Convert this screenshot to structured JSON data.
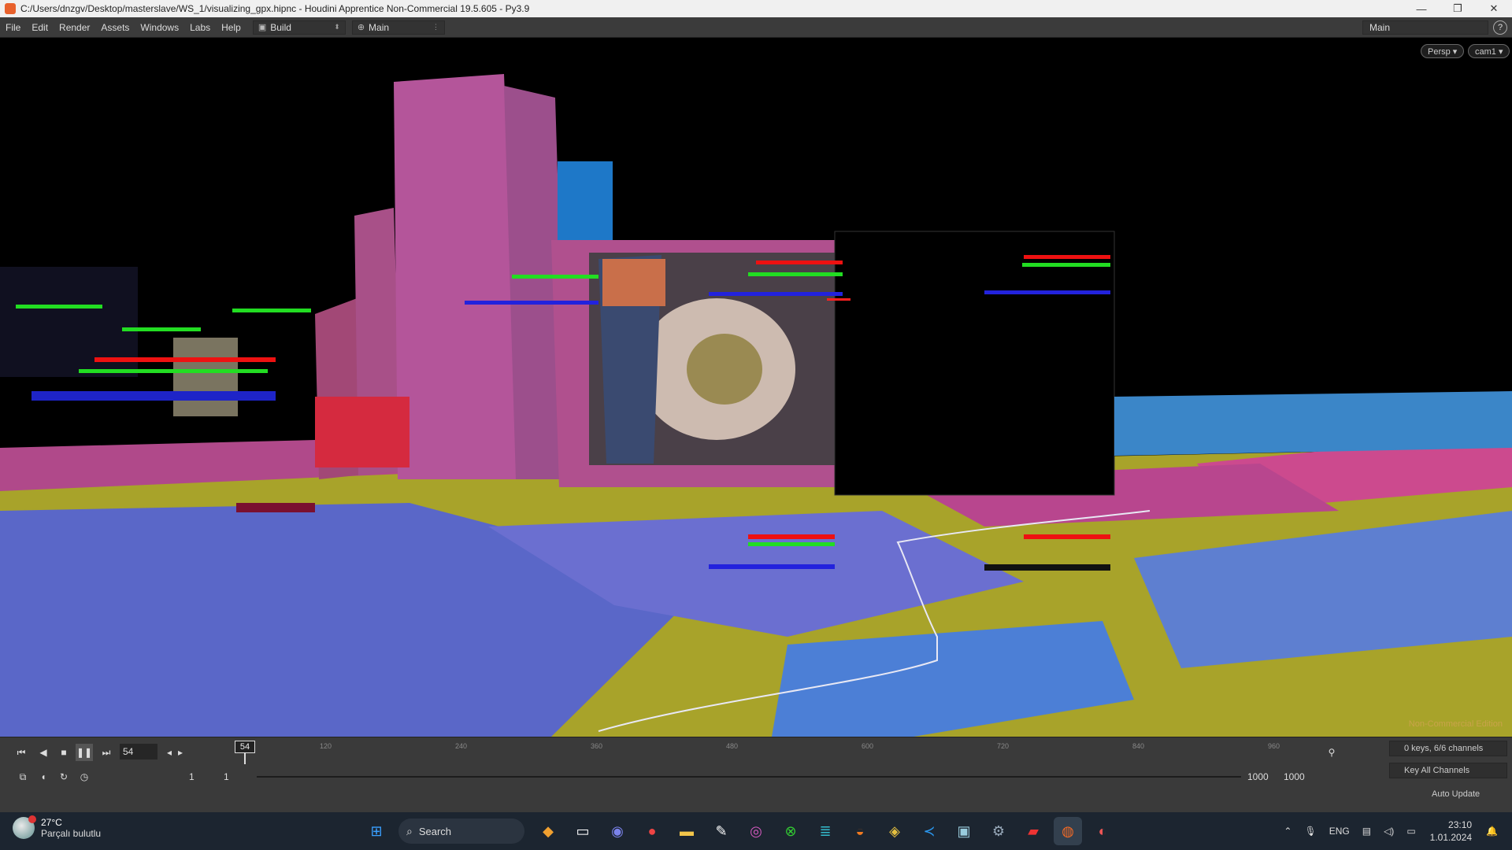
{
  "window": {
    "title": "C:/Users/dnzgv/Desktop/masterslave/WS_1/visualizing_gpx.hipnc - Houdini Apprentice Non-Commercial 19.5.605 - Py3.9",
    "minimize": "—",
    "maximize": "❐",
    "close": "✕"
  },
  "menubar": {
    "items": [
      "File",
      "Edit",
      "Render",
      "Assets",
      "Windows",
      "Labs",
      "Help"
    ],
    "desktop_build": "Build",
    "desktop_main": "Main",
    "right_main": "Main",
    "help": "?"
  },
  "viewport": {
    "persp": "Persp ▾",
    "cam": "cam1 ▾",
    "edition_label": "Non-Commercial Edition",
    "colors": {
      "building_pink": "#b24f88",
      "ground_blue": "#5566cc",
      "ground_yellow": "#a8a32a",
      "blue_box": "#1e78c8",
      "red_base": "#d52a3f"
    }
  },
  "timeline": {
    "current_frame": "54",
    "current_frame_marker": "54",
    "ruler_labels": [
      "120",
      "240",
      "360",
      "480",
      "600",
      "720",
      "840",
      "960"
    ],
    "range_start_a": "1",
    "range_start_b": "1",
    "range_end_a": "1000",
    "range_end_b": "1000",
    "keys_channels": "0 keys, 6/6 channels",
    "key_all_channels": "Key All Channels",
    "auto_update": "Auto Update"
  },
  "taskbar": {
    "weather_temp": "27°C",
    "weather_desc": "Parçalı bulutlu",
    "search_placeholder": "Search",
    "language": "ENG",
    "time": "23:10",
    "date": "1.01.2024",
    "icons": [
      "windows-start-icon",
      "search-icon",
      "widgets-icon",
      "task-view-icon",
      "teams-icon",
      "chrome-icon",
      "file-explorer-icon",
      "inkscape-icon",
      "instagram-icon",
      "xbox-icon",
      "notepad-icon",
      "blender-icon",
      "git-icon",
      "vscode-icon",
      "remote-desktop-icon",
      "settings-icon",
      "acrobat-icon",
      "houdini-icon",
      "maps-icon"
    ]
  }
}
